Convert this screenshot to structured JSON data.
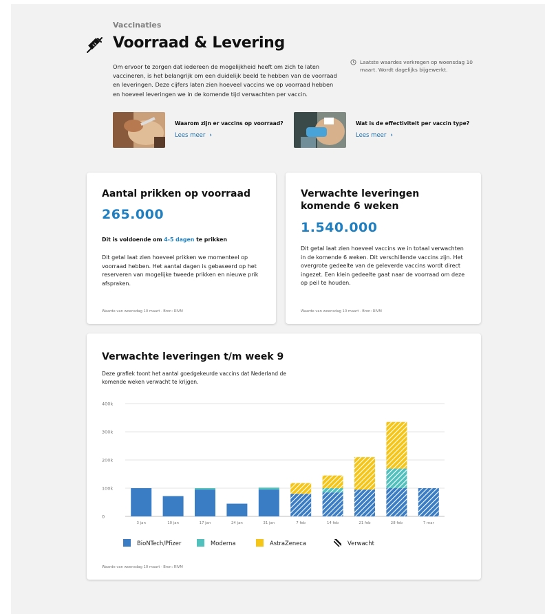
{
  "header": {
    "section_label": "Vaccinaties",
    "title": "Voorraad & Levering",
    "intro": "Om ervoor te zorgen dat iedereen de mogelijkheid heeft om zich te laten vaccineren, is het belangrijk om een duidelijk beeld te hebben van de voorraad en leveringen. Deze cijfers laten zien hoeveel vaccins we op voorraad hebben en hoeveel leveringen we in de komende tijd verwachten per vaccin.",
    "updated": "Laatste waardes verkregen op woensdag 10 maart. Wordt dagelijks bijgewerkt."
  },
  "teasers": [
    {
      "title": "Waarom zijn er vaccins op voorraad?",
      "link": "Lees meer"
    },
    {
      "title": "Wat is de effectiviteit per vaccin type?",
      "link": "Lees meer"
    }
  ],
  "stock_card": {
    "title": "Aantal prikken op voorraad",
    "value": "265.000",
    "sub_prefix": "Dit is voldoende om ",
    "sub_highlight": "4-5 dagen",
    "sub_suffix": " te prikken",
    "body": "Dit getal laat zien hoeveel prikken we momenteel op voorraad hebben. Het aantal dagen is gebaseerd op het reserveren van mogelijke tweede prikken en nieuwe prik afspraken.",
    "source": "Waarde van woensdag 10 maart · Bron: RIVM"
  },
  "delivery_card": {
    "title": "Verwachte leveringen komende 6 weken",
    "value": "1.540.000",
    "body": "Dit getal laat zien hoeveel vaccins we in totaal verwachten in de komende 6 weken. Dit verschillende vaccins zijn. Het overgrote gedeelte van de geleverde vaccins wordt direct ingezet. Een klein gedeelte gaat naar de voorraad om deze op peil te houden.",
    "source": "Waarde van woensdag 10 maart · Bron: RIVM"
  },
  "chart_card": {
    "title": "Verwachte leveringen t/m week 9",
    "description": "Deze grafiek toont het aantal goedgekeurde vaccins dat Nederland de komende weken verwacht te krijgen.",
    "source": "Waarde van woensdag 10 maart · Bron: RIVM"
  },
  "colors": {
    "accent": "#1f7fc0",
    "biontech": "#3a7dc4",
    "moderna": "#52c0bd",
    "astrazeneca": "#f5c518"
  },
  "chart_data": {
    "type": "bar",
    "stacked": true,
    "categories": [
      "3 jan",
      "10 jan",
      "17 jan",
      "24 jan",
      "31 jan",
      "7 feb",
      "14 feb",
      "21 feb",
      "28 feb",
      "7 mar"
    ],
    "yticks": [
      "0",
      "100k",
      "200k",
      "300k",
      "400k"
    ],
    "ylim": [
      0,
      400000
    ],
    "grid": true,
    "legend_position": "bottom",
    "expected_from_index": 5,
    "series": [
      {
        "name": "BioNTech/Pfizer",
        "color": "#3a7dc4",
        "values": [
          100000,
          72000,
          95000,
          45000,
          95000,
          80000,
          85000,
          95000,
          100000,
          100000
        ]
      },
      {
        "name": "Moderna",
        "color": "#52c0bd",
        "values": [
          0,
          0,
          5000,
          0,
          7000,
          0,
          15000,
          0,
          70000,
          0
        ]
      },
      {
        "name": "AstraZeneca",
        "color": "#f5c518",
        "values": [
          0,
          0,
          0,
          0,
          0,
          38000,
          45000,
          115000,
          165000,
          0
        ]
      }
    ],
    "legend": [
      "BioNTech/Pfizer",
      "Moderna",
      "AstraZeneca",
      "Verwacht"
    ]
  }
}
